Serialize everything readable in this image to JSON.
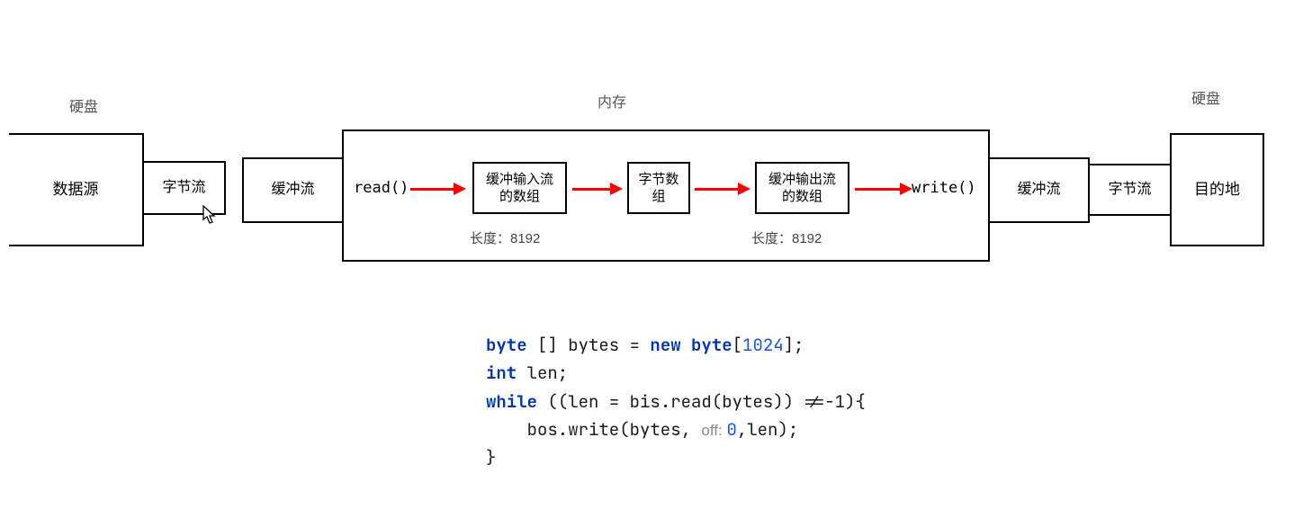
{
  "labels": {
    "disk_left": "硬盘",
    "disk_right": "硬盘",
    "memory": "内存"
  },
  "boxes": {
    "source": "数据源",
    "bytestream_left": "字节流",
    "bufstream_left": "缓冲流",
    "read": "read()",
    "buf_in_array": "缓冲输入流的数组",
    "byte_array": "字节数组",
    "buf_out_array": "缓冲输出流的数组",
    "write": "write()",
    "bufstream_right": "缓冲流",
    "bytestream_right": "字节流",
    "dest": "目的地"
  },
  "sublabels": {
    "len_left": "长度：8192",
    "len_right": "长度：8192"
  },
  "code": {
    "kw_byte": "byte",
    "t1": " [] bytes = ",
    "kw_new": "new",
    "t2": " ",
    "kw_byte2": "byte",
    "t3": "[",
    "num_1024": "1024",
    "t4": "];",
    "kw_int": "int",
    "t5": " len;",
    "kw_while": "while",
    "t6": " ((len = bis.read(bytes)) !=-1){",
    "t7": "    bos.write(bytes, ",
    "hint_off": "off: ",
    "num_0": "0",
    "t8": ",len);",
    "t9": "}"
  }
}
